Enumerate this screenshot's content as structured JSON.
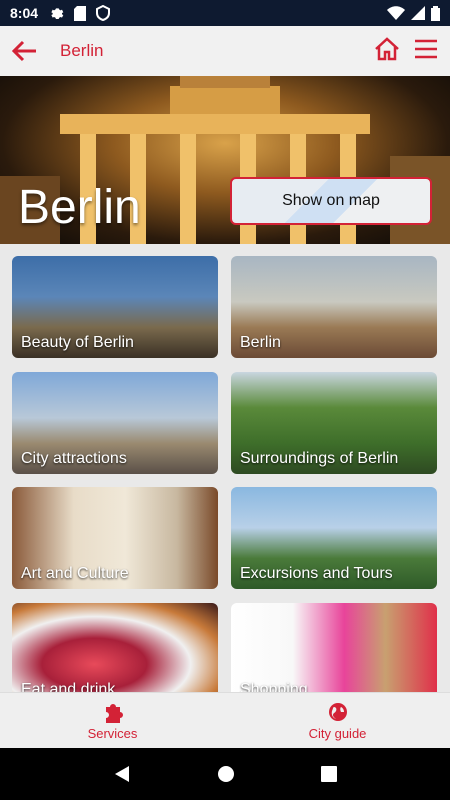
{
  "status_bar": {
    "time": "8:04",
    "icons": [
      "gear-icon",
      "sd-card-icon",
      "shield-icon",
      "wifi-icon",
      "signal-icon",
      "battery-icon"
    ]
  },
  "app_bar": {
    "title": "Berlin",
    "icons": [
      "arrow-left-icon",
      "home-icon",
      "menu-icon"
    ]
  },
  "hero": {
    "city_name": "Berlin",
    "map_button_label": "Show on map"
  },
  "tiles": [
    {
      "label": "Beauty of Berlin"
    },
    {
      "label": "Berlin"
    },
    {
      "label": "City attractions"
    },
    {
      "label": "Surroundings of Berlin"
    },
    {
      "label": "Art and Culture"
    },
    {
      "label": "Excursions and Tours"
    },
    {
      "label": "Eat and drink"
    },
    {
      "label": "Shopping"
    }
  ],
  "bottom_nav": {
    "items": [
      {
        "label": "Services",
        "icon": "puzzle-icon"
      },
      {
        "label": "City guide",
        "icon": "globe-icon"
      }
    ]
  },
  "system_nav": {
    "icons": [
      "back-triangle-icon",
      "home-circle-icon",
      "recents-square-icon"
    ]
  },
  "colors": {
    "accent": "#d32236",
    "status_bar": "#0e1a30",
    "app_bar": "#f1f1f1"
  }
}
